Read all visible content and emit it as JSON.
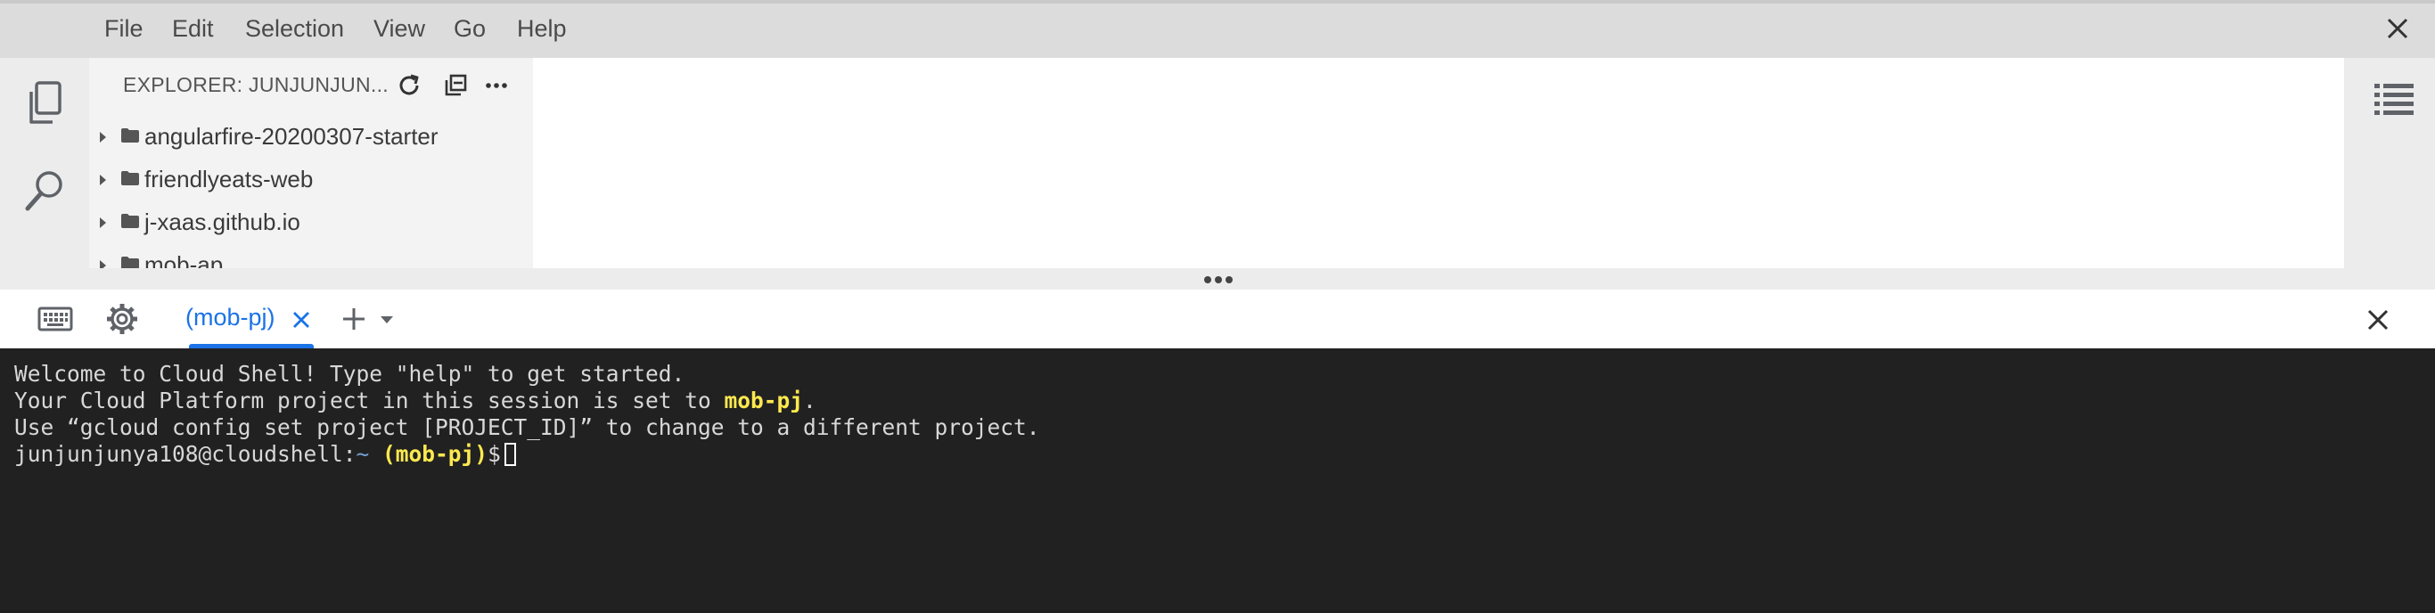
{
  "menubar": {
    "items": [
      "File",
      "Edit",
      "Selection",
      "View",
      "Go",
      "Help"
    ]
  },
  "activity_bar": {
    "icons": [
      "explorer-files-icon",
      "search-icon"
    ]
  },
  "explorer": {
    "title": "EXPLORER: JUNJUNJUN...",
    "actions": [
      "refresh-icon",
      "collapse-all-icon",
      "more-icon"
    ],
    "items": [
      {
        "label": "angularfire-20200307-starter"
      },
      {
        "label": "friendlyeats-web"
      },
      {
        "label": "j-xaas.github.io"
      },
      {
        "label": "mob-ap"
      }
    ]
  },
  "terminal_tabs": {
    "active_tab": "(mob-pj)",
    "icons": [
      "keyboard-icon",
      "settings-icon",
      "add-icon",
      "dropdown-icon",
      "close-icon"
    ]
  },
  "terminal": {
    "line1": "Welcome to Cloud Shell! Type \"help\" to get started.",
    "line2_prefix": "Your Cloud Platform project in this session is set to ",
    "line2_project": "mob-pj",
    "line2_suffix": ".",
    "line3": "Use “gcloud config set project [PROJECT_ID]” to change to a different project.",
    "prompt_user": "junjunjunya108@cloudshell:",
    "prompt_path": "~",
    "prompt_project": "(mob-pj)",
    "prompt_symbol": "$"
  },
  "colors": {
    "accent": "#1a73e8",
    "terminal_bg": "#212121",
    "terminal_highlight": "#fce94f"
  }
}
